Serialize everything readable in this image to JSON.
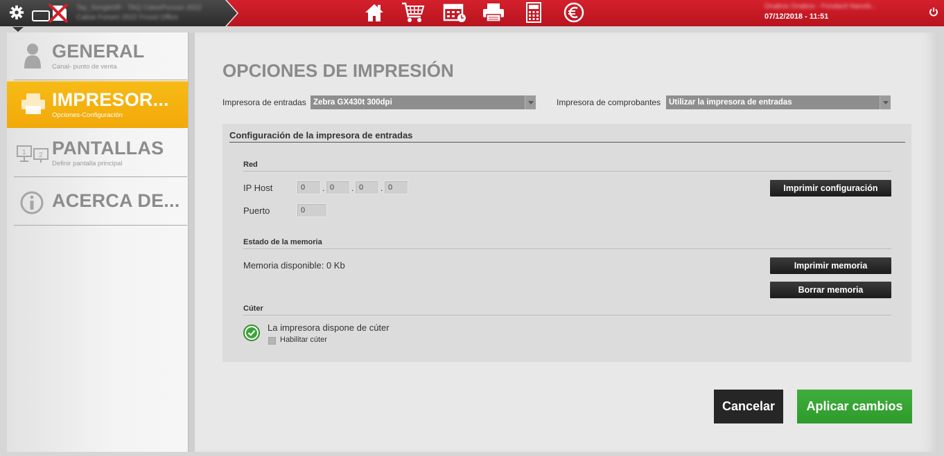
{
  "header": {
    "session_line1": "Tay_Songle0R - TAQ CatsePocson 2022",
    "session_line2": "Cabse Forsen 2022 Frosst Office",
    "user_info": "Onabos Onabos - Fondacit Nanols...",
    "datetime": "07/12/2018 - 11:51",
    "nav_icons": [
      "home-icon",
      "cart-icon",
      "calendar-icon",
      "printer-icon",
      "calculator-icon",
      "euro-icon"
    ]
  },
  "sidebar": {
    "items": [
      {
        "title": "GENERAL",
        "subtitle": "Canal- punto de venta"
      },
      {
        "title": "IMPRESOR...",
        "subtitle": "Opciones-Configuración"
      },
      {
        "title": "PANTALLAS",
        "subtitle": "Definir pantalla principal"
      },
      {
        "title": "ACERCA DE...",
        "subtitle": ""
      }
    ],
    "active_index": 1
  },
  "main": {
    "title": "OPCIONES DE IMPRESIÓN",
    "ticket_printer": {
      "label": "Impresora de entradas",
      "value": "Zebra GX430t 300dpi"
    },
    "receipt_printer": {
      "label": "Impresora de comprobantes",
      "value": "Utilizar la impresora de entradas"
    },
    "config": {
      "title": "Configuración de la impresora de entradas",
      "network": {
        "title": "Red",
        "ip_label": "IP Host",
        "ip": [
          "0",
          "0",
          "0",
          "0"
        ],
        "ip_separator": ".",
        "port_label": "Puerto",
        "port": "0",
        "print_config_button": "Imprimir configuración"
      },
      "memory": {
        "title": "Estado de la memoria",
        "available": "Memoria disponible: 0 Kb",
        "print_button": "Imprimir memoria",
        "clear_button": "Borrar memoria"
      },
      "cutter": {
        "title": "Cúter",
        "status": "La impresora dispone de cúter",
        "enable_label": "Habilitar cúter",
        "enabled": false
      }
    },
    "cancel_button": "Cancelar",
    "apply_button": "Aplicar cambios"
  },
  "colors": {
    "topbar_red": "#c81a25",
    "active_yellow": "#f4b10e",
    "apply_green": "#36a333",
    "dark_button": "#262626"
  }
}
